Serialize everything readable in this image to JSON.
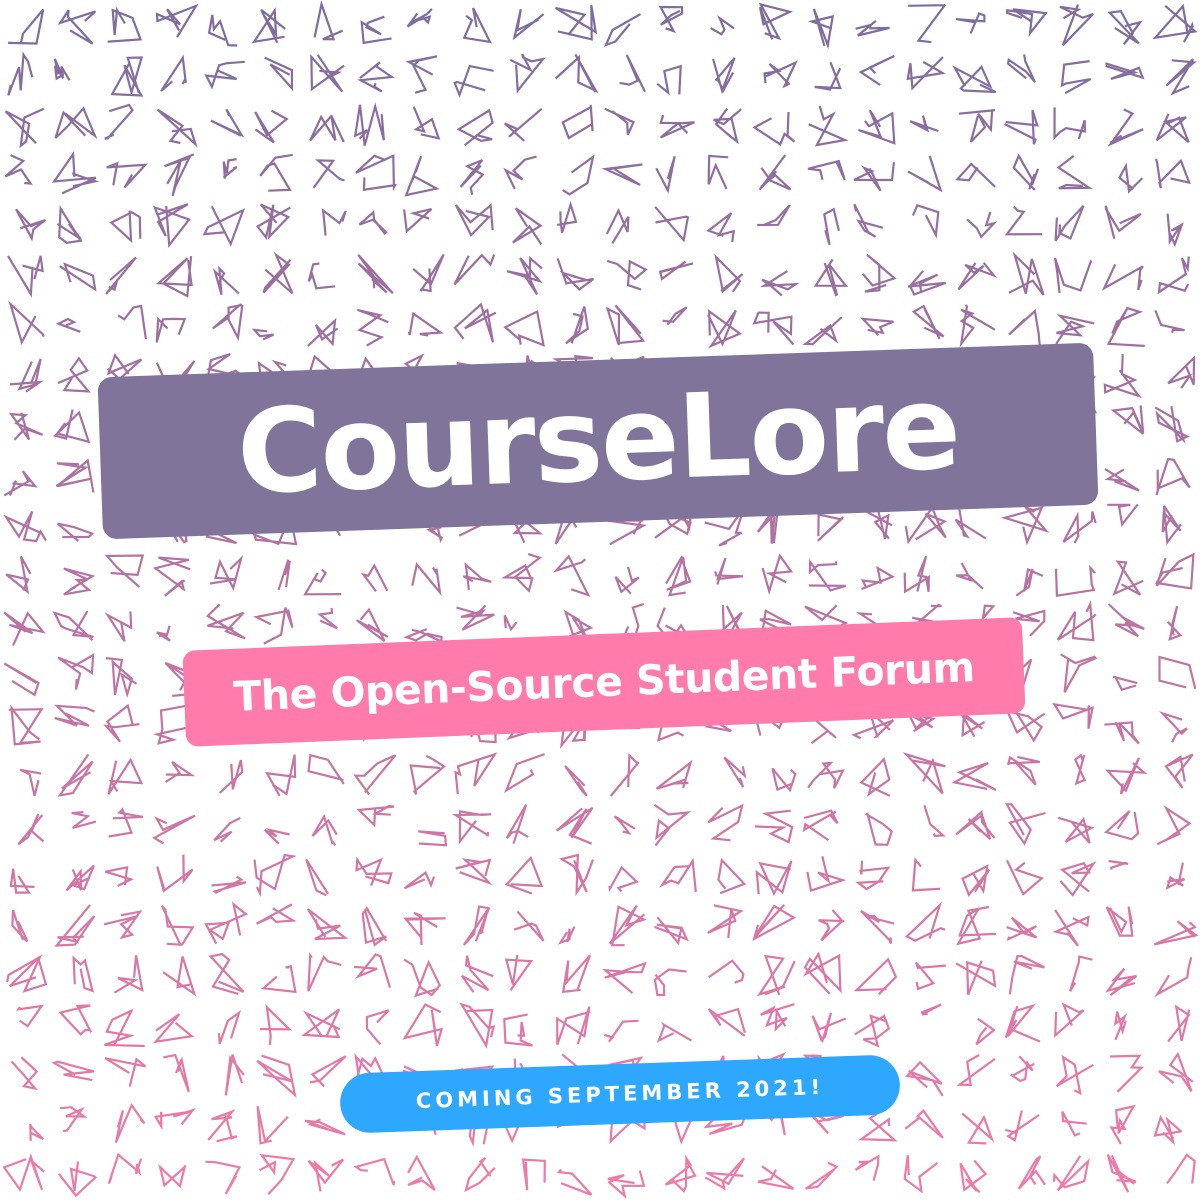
{
  "poster": {
    "title": "CourseLore",
    "subtitle": "The Open-Source Student Forum",
    "badge": "COMING SEPTEMBER 2021!"
  },
  "colors": {
    "background": "#ffffff",
    "title_box": "#80749b",
    "subtitle_box": "#ff7bab",
    "badge_box": "#2ea8ff",
    "pattern_top": "#7f6c9e",
    "pattern_bottom": "#f07aa8",
    "text": "#ffffff"
  },
  "pattern": {
    "style": "random zigzag doodle strokes",
    "gradient_direction": "top-to-bottom"
  }
}
